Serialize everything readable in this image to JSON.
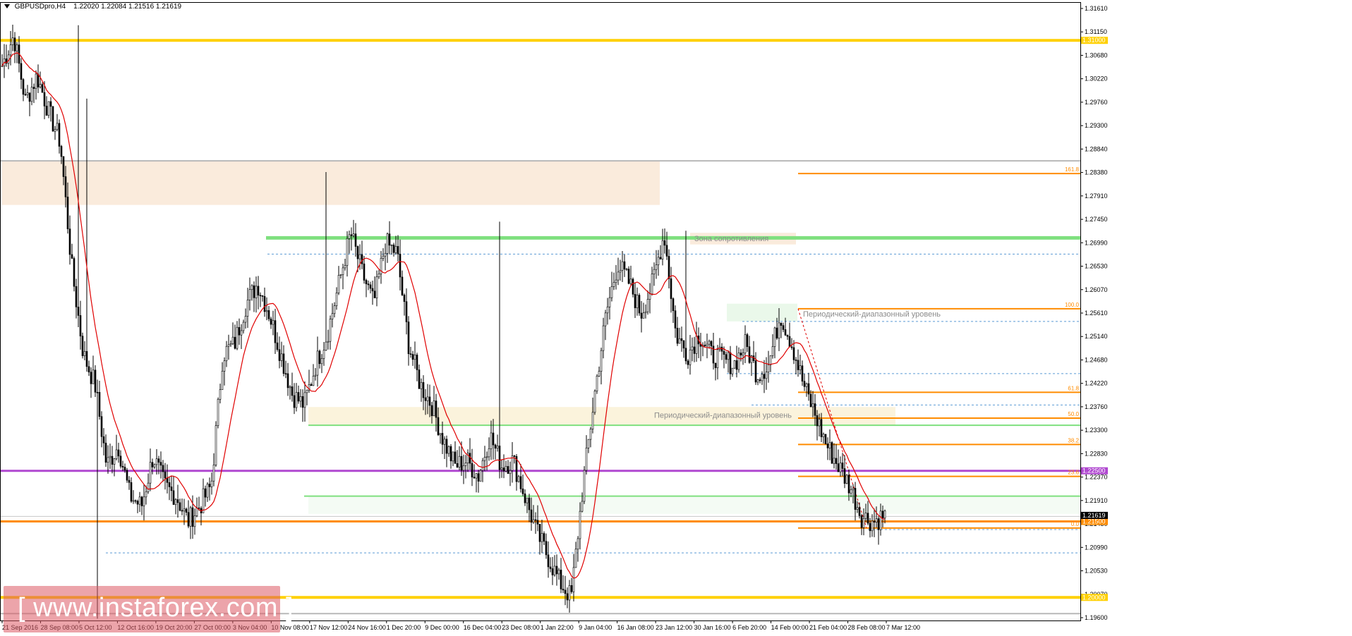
{
  "header": {
    "symbol": "GBPUSDpro,H4",
    "ohlc": "1.22020 1.22084 1.21516 1.21619"
  },
  "watermark": {
    "text": "[ www.instaforex.com ]"
  },
  "chart_data": {
    "type": "candlestick",
    "title": "",
    "instrument": "GBPUSDpro",
    "timeframe": "H4",
    "ylim": [
      1.196,
      1.3163
    ],
    "y_ticks": [
      "1.31610",
      "1.31150",
      "1.30680",
      "1.30220",
      "1.29760",
      "1.29300",
      "1.28840",
      "1.28380",
      "1.27910",
      "1.27450",
      "1.26990",
      "1.26530",
      "1.26070",
      "1.25610",
      "1.25140",
      "1.24680",
      "1.24220",
      "1.23760",
      "1.23300",
      "1.22830",
      "1.22370",
      "1.21910",
      "1.21450",
      "1.20990",
      "1.20530",
      "1.20070",
      "1.19600"
    ],
    "x_labels": [
      "21 Sep 2016",
      "28 Sep 08:00",
      "5 Oct 12:00",
      "12 Oct 16:00",
      "19 Oct 20:00",
      "27 Oct 00:00",
      "3 Nov 04:00",
      "10 Nov 08:00",
      "17 Nov 12:00",
      "24 Nov 16:00",
      "1 Dec 20:00",
      "9 Dec 00:00",
      "16 Dec 04:00",
      "23 Dec 08:00",
      "1 Jan 22:00",
      "9 Jan 04:00",
      "16 Jan 08:00",
      "23 Jan 12:00",
      "30 Jan 16:00",
      "6 Feb 20:00",
      "14 Feb 00:00",
      "21 Feb 04:00",
      "28 Feb 08:00",
      "7 Mar 12:00"
    ],
    "close_path": [
      1.305,
      1.311,
      1.298,
      1.303,
      1.296,
      1.29,
      1.265,
      1.248,
      1.242,
      1.226,
      1.23,
      1.22,
      1.218,
      1.228,
      1.222,
      1.22,
      1.215,
      1.218,
      1.222,
      1.248,
      1.25,
      1.258,
      1.262,
      1.256,
      1.248,
      1.24,
      1.238,
      1.246,
      1.252,
      1.262,
      1.272,
      1.264,
      1.258,
      1.27,
      1.268,
      1.25,
      1.242,
      1.238,
      1.231,
      1.226,
      1.227,
      1.224,
      1.232,
      1.226,
      1.227,
      1.22,
      1.213,
      1.208,
      1.203,
      1.2,
      1.222,
      1.24,
      1.256,
      1.266,
      1.262,
      1.256,
      1.262,
      1.272,
      1.252,
      1.248,
      1.252,
      1.248,
      1.247,
      1.246,
      1.25,
      1.244,
      1.246,
      1.256,
      1.25,
      1.242,
      1.236,
      1.23,
      1.226,
      1.222,
      1.216,
      1.215,
      1.2162
    ],
    "last_price": "1.21619",
    "indicators": [
      {
        "name": "MA",
        "color": "#e00000"
      }
    ],
    "levels": [
      {
        "price": 1.31,
        "label": "1.31000",
        "color": "#ffd000"
      },
      {
        "price": 1.2,
        "label": "1.20000",
        "color": "#ffd000"
      },
      {
        "price": 1.225,
        "label": "1.22500",
        "color": "#b048d0"
      },
      {
        "price": 1.215,
        "label": "1.21500",
        "color": "#ff8c00"
      }
    ],
    "fibonacci": [
      {
        "level": "161.8",
        "price": 1.2837
      },
      {
        "level": "100.0",
        "price": 1.257
      },
      {
        "level": "61.8",
        "price": 1.2405
      },
      {
        "level": "50.0",
        "price": 1.2354
      },
      {
        "level": "38.2",
        "price": 1.2302
      },
      {
        "level": "23.6",
        "price": 1.2239
      },
      {
        "level": "0.0",
        "price": 1.2137
      }
    ],
    "annotations": [
      {
        "text": "Зона сопротивления"
      },
      {
        "text": "Периодический-диапазонный уровень",
        "index": 1
      },
      {
        "text": "Периодический-диапазонный уровень",
        "index": 2
      }
    ],
    "colors": {
      "candle": "#000000",
      "resistance_zone": "#faebdc",
      "range_zone_1": "#fbf3dc",
      "green_level": "#7fe07f",
      "blue_dotted": "#5b9bd5"
    }
  }
}
